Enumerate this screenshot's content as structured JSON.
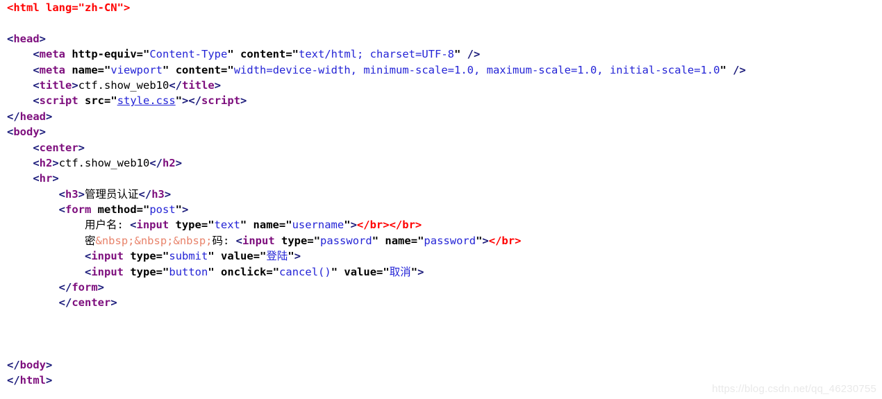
{
  "page": {
    "kind": "syntax-highlighted-code-listing",
    "language": "html",
    "background_color": "#ffffff",
    "font_style": "bold monospace"
  },
  "colors": {
    "bracket": "#1a1a7a",
    "tag_name": "#7d0e7d",
    "attribute_name": "#000000",
    "attribute_value": "#2424d6",
    "text_content": "#000000",
    "entity": "#e8836b",
    "error_red": "#ff0000",
    "link": "#2424d6",
    "watermark": "#e9e9e9"
  },
  "code": {
    "lines": [
      {
        "id": 1,
        "indent": 0,
        "tokens": [
          {
            "t": "err",
            "v": "<html lang=\"zh-CN\">"
          }
        ]
      },
      {
        "id": 2,
        "indent": 0,
        "tokens": []
      },
      {
        "id": 3,
        "indent": 0,
        "tokens": [
          {
            "t": "br",
            "v": "<"
          },
          {
            "t": "tag",
            "v": "head"
          },
          {
            "t": "br",
            "v": ">"
          }
        ]
      },
      {
        "id": 4,
        "indent": 4,
        "tokens": [
          {
            "t": "br",
            "v": "<"
          },
          {
            "t": "tag",
            "v": "meta"
          },
          {
            "t": "attr",
            "v": " http-equiv"
          },
          {
            "t": "eq",
            "v": "="
          },
          {
            "t": "q",
            "v": "\""
          },
          {
            "t": "val",
            "v": "Content-Type"
          },
          {
            "t": "q",
            "v": "\""
          },
          {
            "t": "attr",
            "v": " content"
          },
          {
            "t": "eq",
            "v": "="
          },
          {
            "t": "q",
            "v": "\""
          },
          {
            "t": "val",
            "v": "text/html; charset=UTF-8"
          },
          {
            "t": "q",
            "v": "\""
          },
          {
            "t": "br",
            "v": " />"
          }
        ]
      },
      {
        "id": 5,
        "indent": 4,
        "tokens": [
          {
            "t": "br",
            "v": "<"
          },
          {
            "t": "tag",
            "v": "meta"
          },
          {
            "t": "attr",
            "v": " name"
          },
          {
            "t": "eq",
            "v": "="
          },
          {
            "t": "q",
            "v": "\""
          },
          {
            "t": "val",
            "v": "viewport"
          },
          {
            "t": "q",
            "v": "\""
          },
          {
            "t": "attr",
            "v": " content"
          },
          {
            "t": "eq",
            "v": "="
          },
          {
            "t": "q",
            "v": "\""
          },
          {
            "t": "val",
            "v": "width=device-width, minimum-scale=1.0, maximum-scale=1.0, initial-scale=1.0"
          },
          {
            "t": "q",
            "v": "\""
          },
          {
            "t": "br",
            "v": " />"
          }
        ]
      },
      {
        "id": 6,
        "indent": 4,
        "tokens": [
          {
            "t": "br",
            "v": "<"
          },
          {
            "t": "tag",
            "v": "title"
          },
          {
            "t": "br",
            "v": ">"
          },
          {
            "t": "txt",
            "v": "ctf.show_web10"
          },
          {
            "t": "br",
            "v": "</"
          },
          {
            "t": "tag",
            "v": "title"
          },
          {
            "t": "br",
            "v": ">"
          }
        ]
      },
      {
        "id": 7,
        "indent": 4,
        "tokens": [
          {
            "t": "br",
            "v": "<"
          },
          {
            "t": "tag",
            "v": "script"
          },
          {
            "t": "attr",
            "v": " src"
          },
          {
            "t": "eq",
            "v": "="
          },
          {
            "t": "q",
            "v": "\""
          },
          {
            "t": "link",
            "v": "style.css"
          },
          {
            "t": "q",
            "v": "\""
          },
          {
            "t": "br",
            "v": ">"
          },
          {
            "t": "br",
            "v": "</"
          },
          {
            "t": "tag",
            "v": "script"
          },
          {
            "t": "br",
            "v": ">"
          }
        ]
      },
      {
        "id": 8,
        "indent": 0,
        "tokens": [
          {
            "t": "br",
            "v": "</"
          },
          {
            "t": "tag",
            "v": "head"
          },
          {
            "t": "br",
            "v": ">"
          }
        ]
      },
      {
        "id": 9,
        "indent": 0,
        "tokens": [
          {
            "t": "br",
            "v": "<"
          },
          {
            "t": "tag",
            "v": "body"
          },
          {
            "t": "br",
            "v": ">"
          }
        ]
      },
      {
        "id": 10,
        "indent": 4,
        "tokens": [
          {
            "t": "br",
            "v": "<"
          },
          {
            "t": "tag",
            "v": "center"
          },
          {
            "t": "br",
            "v": ">"
          }
        ]
      },
      {
        "id": 11,
        "indent": 4,
        "tokens": [
          {
            "t": "br",
            "v": "<"
          },
          {
            "t": "tag",
            "v": "h2"
          },
          {
            "t": "br",
            "v": ">"
          },
          {
            "t": "txt",
            "v": "ctf.show_web10"
          },
          {
            "t": "br",
            "v": "</"
          },
          {
            "t": "tag",
            "v": "h2"
          },
          {
            "t": "br",
            "v": ">"
          }
        ]
      },
      {
        "id": 12,
        "indent": 4,
        "tokens": [
          {
            "t": "br",
            "v": "<"
          },
          {
            "t": "tag",
            "v": "hr"
          },
          {
            "t": "br",
            "v": ">"
          }
        ]
      },
      {
        "id": 13,
        "indent": 8,
        "tokens": [
          {
            "t": "br",
            "v": "<"
          },
          {
            "t": "tag",
            "v": "h3"
          },
          {
            "t": "br",
            "v": ">"
          },
          {
            "t": "txt",
            "v": "管理员认证"
          },
          {
            "t": "br",
            "v": "</"
          },
          {
            "t": "tag",
            "v": "h3"
          },
          {
            "t": "br",
            "v": ">"
          }
        ]
      },
      {
        "id": 14,
        "indent": 8,
        "tokens": [
          {
            "t": "br",
            "v": "<"
          },
          {
            "t": "tag",
            "v": "form"
          },
          {
            "t": "attr",
            "v": " method"
          },
          {
            "t": "eq",
            "v": "="
          },
          {
            "t": "q",
            "v": "\""
          },
          {
            "t": "val",
            "v": "post"
          },
          {
            "t": "q",
            "v": "\""
          },
          {
            "t": "br",
            "v": ">"
          }
        ]
      },
      {
        "id": 15,
        "indent": 12,
        "tokens": [
          {
            "t": "txt",
            "v": "用户名: "
          },
          {
            "t": "br",
            "v": "<"
          },
          {
            "t": "tag",
            "v": "input"
          },
          {
            "t": "attr",
            "v": " type"
          },
          {
            "t": "eq",
            "v": "="
          },
          {
            "t": "q",
            "v": "\""
          },
          {
            "t": "val",
            "v": "text"
          },
          {
            "t": "q",
            "v": "\""
          },
          {
            "t": "attr",
            "v": " name"
          },
          {
            "t": "eq",
            "v": "="
          },
          {
            "t": "q",
            "v": "\""
          },
          {
            "t": "val",
            "v": "username"
          },
          {
            "t": "q",
            "v": "\""
          },
          {
            "t": "br",
            "v": ">"
          },
          {
            "t": "err",
            "v": "</br>"
          },
          {
            "t": "err",
            "v": "</br>"
          }
        ]
      },
      {
        "id": 16,
        "indent": 12,
        "tokens": [
          {
            "t": "txt",
            "v": "密"
          },
          {
            "t": "ent",
            "v": "&nbsp;"
          },
          {
            "t": "ent",
            "v": "&nbsp;"
          },
          {
            "t": "ent",
            "v": "&nbsp;"
          },
          {
            "t": "txt",
            "v": "码: "
          },
          {
            "t": "br",
            "v": "<"
          },
          {
            "t": "tag",
            "v": "input"
          },
          {
            "t": "attr",
            "v": " type"
          },
          {
            "t": "eq",
            "v": "="
          },
          {
            "t": "q",
            "v": "\""
          },
          {
            "t": "val",
            "v": "password"
          },
          {
            "t": "q",
            "v": "\""
          },
          {
            "t": "attr",
            "v": " name"
          },
          {
            "t": "eq",
            "v": "="
          },
          {
            "t": "q",
            "v": "\""
          },
          {
            "t": "val",
            "v": "password"
          },
          {
            "t": "q",
            "v": "\""
          },
          {
            "t": "br",
            "v": ">"
          },
          {
            "t": "err",
            "v": "</br>"
          }
        ]
      },
      {
        "id": 17,
        "indent": 12,
        "tokens": [
          {
            "t": "br",
            "v": "<"
          },
          {
            "t": "tag",
            "v": "input"
          },
          {
            "t": "attr",
            "v": " type"
          },
          {
            "t": "eq",
            "v": "="
          },
          {
            "t": "q",
            "v": "\""
          },
          {
            "t": "val",
            "v": "submit"
          },
          {
            "t": "q",
            "v": "\""
          },
          {
            "t": "attr",
            "v": " value"
          },
          {
            "t": "eq",
            "v": "="
          },
          {
            "t": "q",
            "v": "\""
          },
          {
            "t": "val",
            "v": "登陆"
          },
          {
            "t": "q",
            "v": "\""
          },
          {
            "t": "br",
            "v": ">"
          }
        ]
      },
      {
        "id": 18,
        "indent": 12,
        "tokens": [
          {
            "t": "br",
            "v": "<"
          },
          {
            "t": "tag",
            "v": "input"
          },
          {
            "t": "attr",
            "v": " type"
          },
          {
            "t": "eq",
            "v": "="
          },
          {
            "t": "q",
            "v": "\""
          },
          {
            "t": "val",
            "v": "button"
          },
          {
            "t": "q",
            "v": "\""
          },
          {
            "t": "attr",
            "v": " onclick"
          },
          {
            "t": "eq",
            "v": "="
          },
          {
            "t": "q",
            "v": "\""
          },
          {
            "t": "val",
            "v": "cancel()"
          },
          {
            "t": "q",
            "v": "\""
          },
          {
            "t": "attr",
            "v": " value"
          },
          {
            "t": "eq",
            "v": "="
          },
          {
            "t": "q",
            "v": "\""
          },
          {
            "t": "val",
            "v": "取消"
          },
          {
            "t": "q",
            "v": "\""
          },
          {
            "t": "br",
            "v": ">"
          }
        ]
      },
      {
        "id": 19,
        "indent": 8,
        "tokens": [
          {
            "t": "br",
            "v": "</"
          },
          {
            "t": "tag",
            "v": "form"
          },
          {
            "t": "br",
            "v": ">"
          }
        ]
      },
      {
        "id": 20,
        "indent": 8,
        "tokens": [
          {
            "t": "br",
            "v": "</"
          },
          {
            "t": "tag",
            "v": "center"
          },
          {
            "t": "br",
            "v": ">"
          }
        ]
      },
      {
        "id": 21,
        "indent": 0,
        "tokens": []
      },
      {
        "id": 22,
        "indent": 0,
        "tokens": []
      },
      {
        "id": 23,
        "indent": 0,
        "tokens": []
      },
      {
        "id": 24,
        "indent": 0,
        "tokens": [
          {
            "t": "br",
            "v": "</"
          },
          {
            "t": "tag",
            "v": "body"
          },
          {
            "t": "br",
            "v": ">"
          }
        ]
      },
      {
        "id": 25,
        "indent": 0,
        "tokens": [
          {
            "t": "br",
            "v": "</"
          },
          {
            "t": "tag",
            "v": "html"
          },
          {
            "t": "br",
            "v": ">"
          }
        ]
      }
    ]
  },
  "watermark": {
    "text": "https://blog.csdn.net/qq_46230755"
  }
}
